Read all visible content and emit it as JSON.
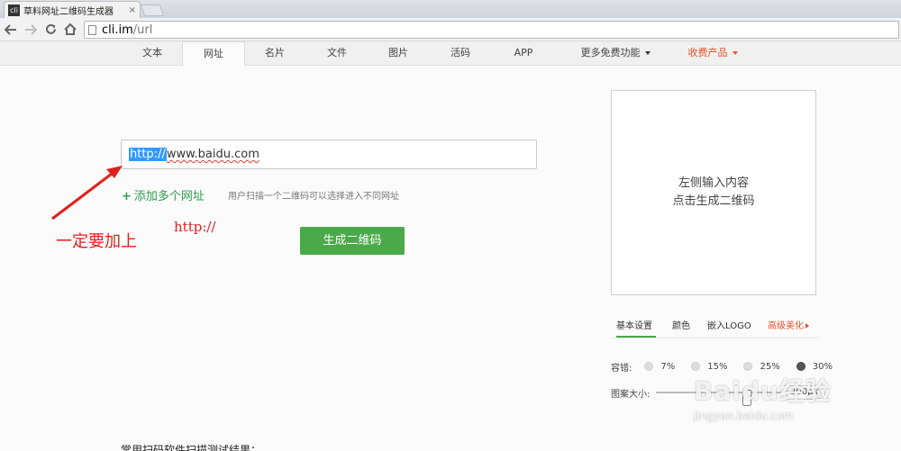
{
  "browser": {
    "tab_title": "草料网址二维码生成器",
    "tab_favicon": "cli",
    "tab_close": "×",
    "url_host": "cli.im",
    "url_path": "/url"
  },
  "sitenav": {
    "items": [
      {
        "label": "文本"
      },
      {
        "label": "网址"
      },
      {
        "label": "名片"
      },
      {
        "label": "文件"
      },
      {
        "label": "图片"
      },
      {
        "label": "活码"
      },
      {
        "label": "APP"
      },
      {
        "label": "更多免费功能"
      },
      {
        "label": "收费产品"
      }
    ],
    "active_index": 1
  },
  "main": {
    "url_selected": "http://",
    "url_rest": "www.baidu.com",
    "add_url_plus": "+",
    "add_url_label": "添加多个网址",
    "add_url_hint": "用户扫描一个二维码可以选择进入不同网址",
    "generate_label": "生成二维码",
    "bottom_text": "常用扫码软件扫描测试结果："
  },
  "annotations": {
    "must_add": "一定要加上",
    "http": "http://"
  },
  "preview": {
    "line1": "左侧输入内容",
    "line2": "点击生成二维码"
  },
  "settings": {
    "tabs": [
      {
        "label": "基本设置"
      },
      {
        "label": "颜色"
      },
      {
        "label": "嵌入LOGO"
      },
      {
        "label": "高级美化"
      }
    ],
    "ec_label": "容错:",
    "ec_options": [
      "7%",
      "15%",
      "25%",
      "30%"
    ],
    "ec_selected": "30%",
    "size_label": "图案大小:",
    "size_value": "200px"
  },
  "watermark": {
    "logo": "Baidu经验",
    "sub": "jingyan.baidu.com"
  },
  "colors": {
    "accent_green": "#4aaa4a",
    "link_green": "#2e9e4e",
    "orange": "#e8532b",
    "annotation_red": "#e0201a",
    "selection_blue": "#3399ff"
  }
}
